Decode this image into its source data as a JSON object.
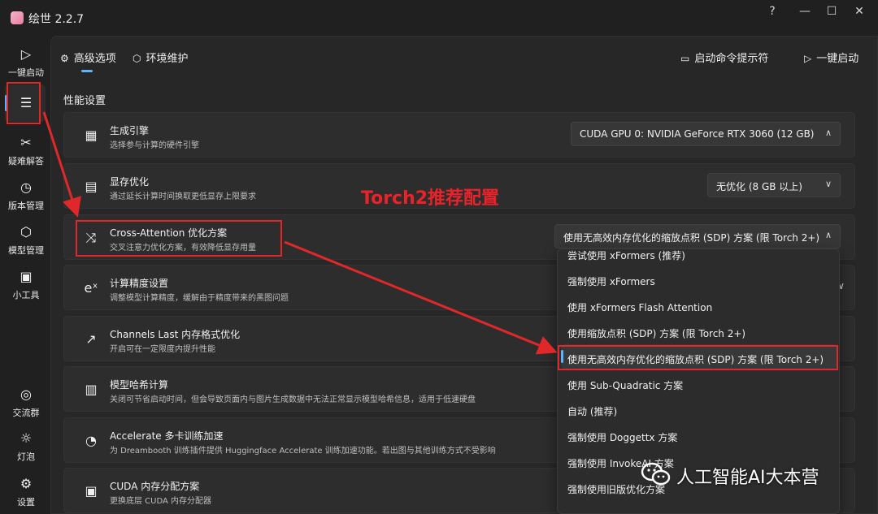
{
  "window": {
    "title": "绘世 2.2.7",
    "controls": {
      "help": "?",
      "minimize": "—",
      "maximize": "☐",
      "close": "✕"
    }
  },
  "rail": {
    "items": [
      {
        "icon": "play-icon",
        "glyph": "▷",
        "label": "一键启动"
      },
      {
        "icon": "list-icon",
        "glyph": "☰",
        "label": ""
      },
      {
        "icon": "tools-icon",
        "glyph": "✂",
        "label": "疑难解答"
      },
      {
        "icon": "history-icon",
        "glyph": "◷",
        "label": "版本管理"
      },
      {
        "icon": "cube-icon",
        "glyph": "⬡",
        "label": "模型管理"
      },
      {
        "icon": "toolbox-icon",
        "glyph": "▣",
        "label": "小工具"
      },
      {
        "icon": "chat-icon",
        "glyph": "◎",
        "label": "交流群"
      },
      {
        "icon": "bulb-icon",
        "glyph": "☼",
        "label": "灯泡"
      },
      {
        "icon": "gear-icon",
        "glyph": "⚙",
        "label": "设置"
      }
    ]
  },
  "tabs": {
    "advanced": {
      "icon": "gear-icon",
      "glyph": "⚙",
      "label": "高级选项"
    },
    "env": {
      "icon": "box-icon",
      "glyph": "⬡",
      "label": "环境维护"
    },
    "console": {
      "icon": "terminal-icon",
      "glyph": "▭",
      "label": "启动命令提示符"
    },
    "launch": {
      "icon": "play-icon",
      "glyph": "▷",
      "label": "一键启动"
    }
  },
  "section_title": "性能设置",
  "cards": [
    {
      "icon": "gpu-icon",
      "glyph": "▦",
      "title": "生成引擎",
      "desc": "选择参与计算的硬件引擎",
      "value": "CUDA GPU 0: NVIDIA GeForce RTX 3060 (12 GB)",
      "chevron": "∧"
    },
    {
      "icon": "memory-icon",
      "glyph": "▤",
      "title": "显存优化",
      "desc": "通过延长计算时间换取更低显存上限要求",
      "value": "无优化 (8 GB 以上)",
      "chevron": "∨"
    },
    {
      "icon": "shuffle-icon",
      "glyph": "⤨",
      "title": "Cross-Attention 优化方案",
      "desc": "交叉注意力优化方案，有效降低显存用量",
      "value": "使用无高效内存优化的缩放点积 (SDP) 方案 (限 Torch 2+)",
      "chevron": "∧"
    },
    {
      "icon": "exponent-icon",
      "glyph": "eˣ",
      "title": "计算精度设置",
      "desc": "调整模型计算精度，缓解由于精度带来的黑图问题",
      "chevron": "∨"
    },
    {
      "icon": "trend-icon",
      "glyph": "↗",
      "title": "Channels Last 内存格式优化",
      "desc": "开启可在一定限度内提升性能"
    },
    {
      "icon": "hash-icon",
      "glyph": "▥",
      "title": "模型哈希计算",
      "desc": "关闭可节省启动时间，但会导致页面内与图片生成数据中无法正常显示模型哈希信息，适用于低速硬盘"
    },
    {
      "icon": "gauge-icon",
      "glyph": "◔",
      "title": "Accelerate 多卡训练加速",
      "desc": "为 Dreambooth 训练插件提供 Huggingface Accelerate 训练加速功能。若出图与其他训练方式不受影响"
    },
    {
      "icon": "chip-icon",
      "glyph": "▣",
      "title": "CUDA 内存分配方案",
      "desc": "更换底层 CUDA 内存分配器"
    }
  ],
  "dropdown_options": [
    "尝试使用 xFormers (推荐)",
    "强制使用 xFormers",
    "使用 xFormers Flash Attention",
    "使用缩放点积 (SDP) 方案 (限 Torch 2+)",
    "使用无高效内存优化的缩放点积 (SDP) 方案 (限 Torch 2+)",
    "使用 Sub-Quadratic 方案",
    "自动 (推荐)",
    "强制使用 Doggettx 方案",
    "强制使用 InvokeAI 方案",
    "强制使用旧版优化方案"
  ],
  "annotation": "Torch2推荐配置",
  "watermark": "人工智能AI大本营",
  "colors": {
    "accent": "#5fb2ff",
    "highlight_red": "#e0282a",
    "background": "#202020",
    "card": "#2d2d2d"
  }
}
